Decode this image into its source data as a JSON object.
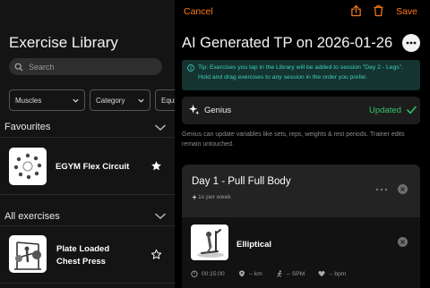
{
  "library": {
    "title": "Exercise Library",
    "search_placeholder": "Search",
    "filters": [
      "Muscles",
      "Category",
      "Equi"
    ],
    "favourites_label": "Favourites",
    "all_label": "All exercises",
    "favourites": [
      {
        "name": "EGYM Flex Circuit"
      }
    ],
    "all": [
      {
        "name_line1": "Plate Loaded",
        "name_line2": "Chest Press"
      }
    ]
  },
  "header": {
    "cancel": "Cancel",
    "save": "Save",
    "accent_color": "#ff7a1a"
  },
  "plan": {
    "title": "AI Generated TP on 2026-01-26",
    "tip": "Tip: Exercises you tap in the Library will be added to session \"Day 2 - Legs\". Hold and drag exercises to any session in the order you prefer.",
    "genius_label": "Genius",
    "genius_status": "Updated",
    "genius_desc": "Genius can update variables like sets, reps, weights & rest periods. Trainer edits remain untouched.",
    "day": {
      "title": "Day 1 - Pull Full Body",
      "frequency": "1x per week",
      "exercise": {
        "name": "Elliptical",
        "duration": "00:15:00",
        "distance": "-- km",
        "spm": "-- SPM",
        "bpm": "-- bpm"
      }
    }
  }
}
